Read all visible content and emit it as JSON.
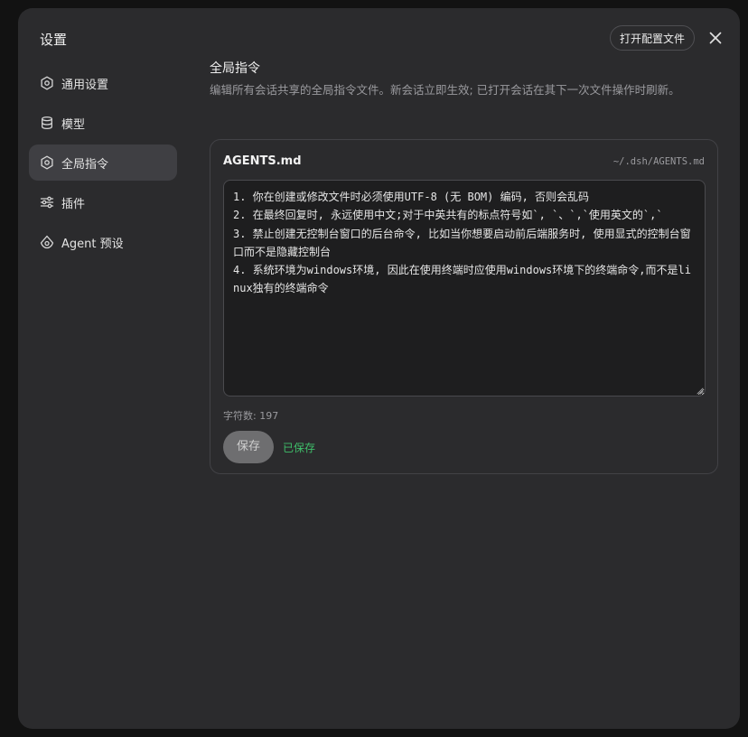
{
  "modal": {
    "title": "设置",
    "open_config_label": "打开配置文件",
    "close_icon": "close-icon"
  },
  "sidebar": {
    "items": [
      {
        "label": "通用设置",
        "icon": "gear-icon",
        "active": false
      },
      {
        "label": "模型",
        "icon": "database-icon",
        "active": false
      },
      {
        "label": "全局指令",
        "icon": "gear-icon",
        "active": true
      },
      {
        "label": "插件",
        "icon": "sliders-icon",
        "active": false
      },
      {
        "label": "Agent 预设",
        "icon": "agent-icon",
        "active": false
      }
    ]
  },
  "content": {
    "title": "全局指令",
    "description": "编辑所有会话共享的全局指令文件。新会话立即生效; 已打开会话在其下一次文件操作时刷新。",
    "file": {
      "name": "AGENTS.md",
      "path": "~/.dsh/AGENTS.md",
      "text": "1. 你在创建或修改文件时必须使用UTF-8 (无 BOM) 编码, 否则会乱码\n2. 在最终回复时, 永远使用中文;对于中英共有的标点符号如`, `、`,`使用英文的`,`\n3. 禁止创建无控制台窗口的后台命令, 比如当你想要启动前后端服务时, 使用显式的控制台窗口而不是隐藏控制台\n4. 系统环境为windows环境, 因此在使用终端时应使用windows环境下的终端命令,而不是linux独有的终端命令"
    },
    "char_count_label": "字符数: 197",
    "save_label": "保存",
    "saved_status": "已保存"
  },
  "colors": {
    "modal_bg": "#2b2b2d",
    "active_nav_bg": "#3f3f43",
    "saved_green": "#3fbf6a",
    "save_button_bg": "#6e6e70"
  }
}
